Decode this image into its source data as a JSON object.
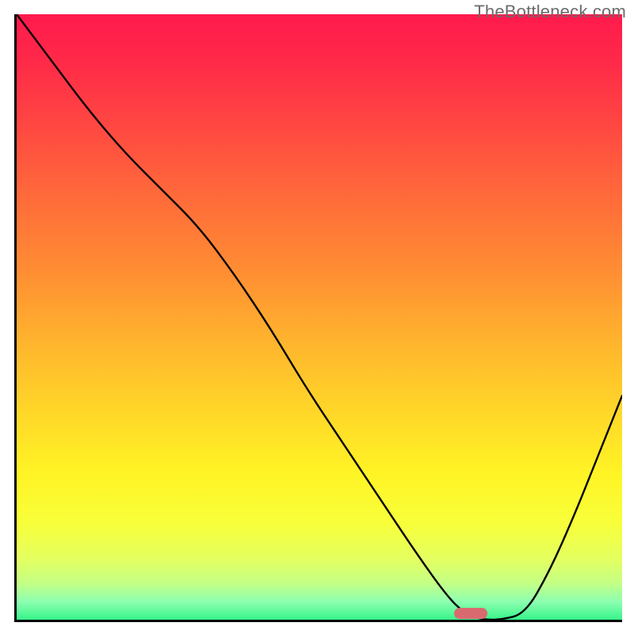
{
  "watermark": "TheBottleneck.com",
  "colors": {
    "gradient_top": "#ff1a4d",
    "gradient_bottom": "#36f48a",
    "curve": "#000000",
    "marker": "#d86a6f",
    "axis": "#000000"
  },
  "chart_data": {
    "type": "line",
    "title": "",
    "xlabel": "",
    "ylabel": "",
    "xlim": [
      0,
      100
    ],
    "ylim": [
      0,
      100
    ],
    "grid": false,
    "legend": false,
    "annotations": [
      {
        "kind": "marker-pill",
        "x": 75,
        "y": 0.5
      }
    ],
    "gradient_stops": [
      {
        "pos": 0,
        "color": "#ff1a4d"
      },
      {
        "pos": 8,
        "color": "#ff2a48"
      },
      {
        "pos": 18,
        "color": "#ff4642"
      },
      {
        "pos": 30,
        "color": "#ff6a3a"
      },
      {
        "pos": 42,
        "color": "#ff8c33"
      },
      {
        "pos": 55,
        "color": "#ffb72d"
      },
      {
        "pos": 66,
        "color": "#ffd828"
      },
      {
        "pos": 76,
        "color": "#fff425"
      },
      {
        "pos": 84,
        "color": "#f8ff3a"
      },
      {
        "pos": 90,
        "color": "#e4ff60"
      },
      {
        "pos": 94,
        "color": "#c3ff85"
      },
      {
        "pos": 97,
        "color": "#8dffb0"
      },
      {
        "pos": 100,
        "color": "#36f48a"
      }
    ],
    "series": [
      {
        "name": "curve",
        "x": [
          0,
          6,
          12,
          18,
          24,
          30,
          36,
          42,
          48,
          54,
          60,
          66,
          71,
          74,
          77,
          80,
          84,
          88,
          92,
          96,
          100
        ],
        "y": [
          100,
          92,
          84,
          77,
          71,
          65,
          57,
          48,
          38,
          29,
          20,
          11,
          4,
          1,
          0,
          0,
          1,
          8,
          17,
          27,
          37
        ]
      }
    ]
  }
}
